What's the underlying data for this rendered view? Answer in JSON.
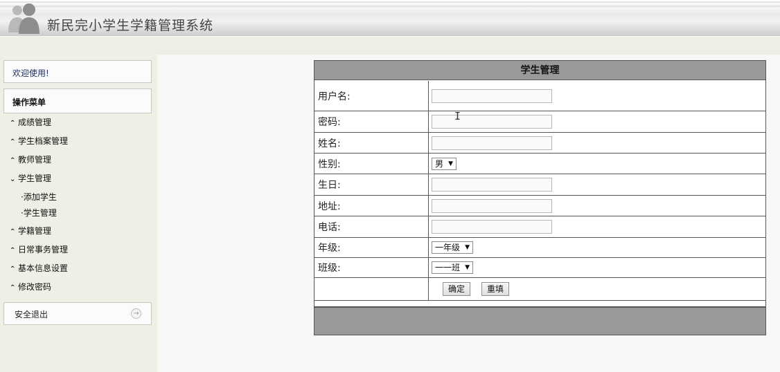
{
  "header": {
    "title": "新民完小学生学籍管理系统"
  },
  "sidebar": {
    "welcome": "欢迎使用!",
    "menu_title": "操作菜单",
    "items": [
      {
        "label": "成绩管理",
        "chevron": "⌃"
      },
      {
        "label": "学生档案管理",
        "chevron": "⌃"
      },
      {
        "label": "教师管理",
        "chevron": "⌃"
      },
      {
        "label": "学生管理",
        "chevron": "⌄"
      }
    ],
    "sub_items": [
      {
        "label": "·添加学生"
      },
      {
        "label": "·学生管理"
      }
    ],
    "items_after": [
      {
        "label": "学籍管理",
        "chevron": "⌃"
      },
      {
        "label": "日常事务管理",
        "chevron": "⌃"
      },
      {
        "label": "基本信息设置",
        "chevron": "⌃"
      },
      {
        "label": "修改密码",
        "chevron": "⌃"
      }
    ],
    "logout": "安全退出",
    "logout_icon": "arrow-right-icon"
  },
  "form": {
    "title": "学生管理",
    "fields": {
      "username": {
        "label": "用户名:",
        "value": ""
      },
      "password": {
        "label": "密码:",
        "value": ""
      },
      "name": {
        "label": "姓名:",
        "value": ""
      },
      "gender": {
        "label": "性别:",
        "selected": "男"
      },
      "birthday": {
        "label": "生日:",
        "value": ""
      },
      "address": {
        "label": "地址:",
        "value": ""
      },
      "phone": {
        "label": "电话:",
        "value": ""
      },
      "grade": {
        "label": "年级:",
        "selected": "一年级"
      },
      "class": {
        "label": "班级:",
        "selected": "一一班"
      }
    },
    "buttons": {
      "confirm": "确定",
      "reset": "重填"
    }
  },
  "colors": {
    "panel_header": "#999999",
    "sidebar_bg": "#efefe6",
    "page_bg": "#f7f7f7"
  }
}
